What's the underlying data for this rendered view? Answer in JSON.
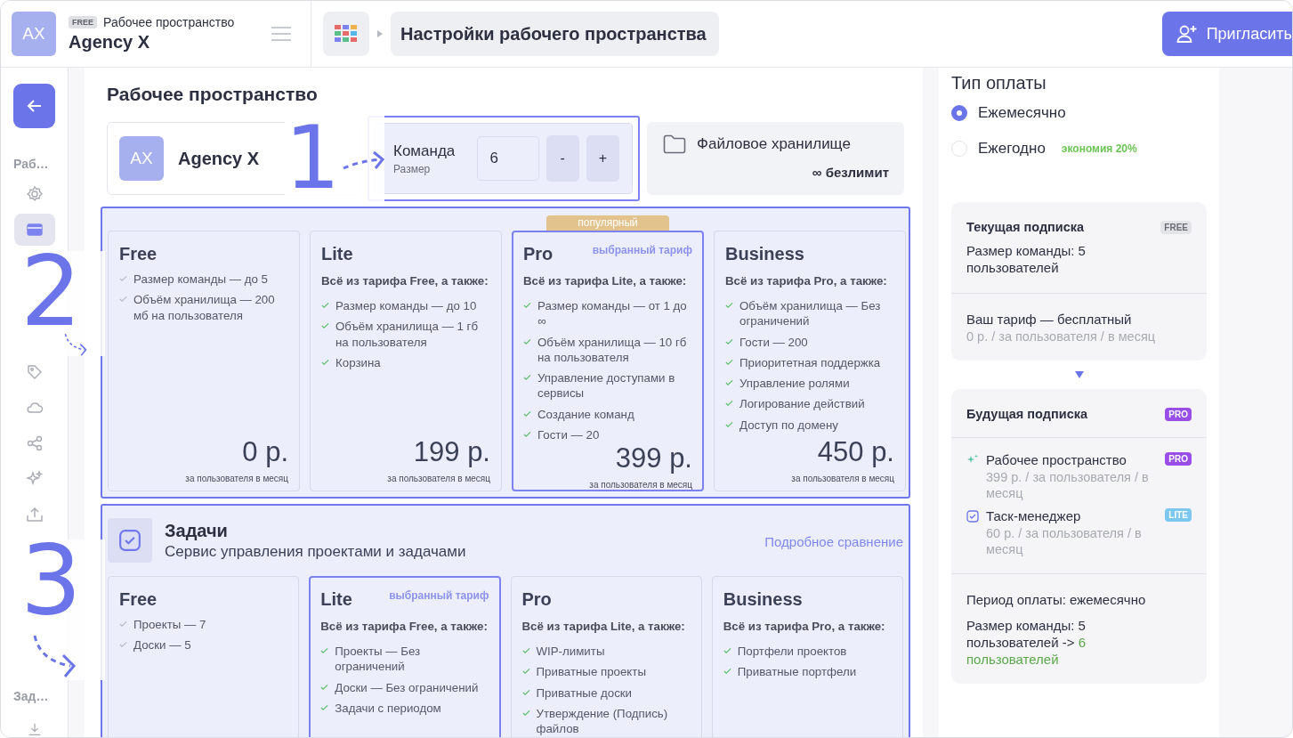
{
  "header": {
    "avatar": "AX",
    "plan_badge": "FREE",
    "workspace_label": "Рабочее пространство",
    "workspace_name": "Agency X",
    "breadcrumb": "Настройки рабочего пространства",
    "invite_button": "Пригласить"
  },
  "sidebar": {
    "back_selected": true,
    "section_1": "Раб…",
    "items": [
      {
        "kind": "gear",
        "selected": false
      },
      {
        "kind": "board",
        "selected": true
      },
      {
        "kind": "step",
        "text": "2"
      },
      {
        "kind": "tag",
        "selected": false
      },
      {
        "kind": "cloud",
        "selected": false
      },
      {
        "kind": "share",
        "selected": false
      },
      {
        "kind": "sparkles",
        "selected": false
      },
      {
        "kind": "upload",
        "selected": false
      },
      {
        "kind": "step",
        "text": "3"
      }
    ],
    "section_2": "Зад…"
  },
  "workspace": {
    "title": "Рабочее пространство",
    "step": "1",
    "avatar": "AX",
    "name": "Agency X",
    "team": {
      "label": "Команда",
      "sublabel": "Размер",
      "value": "6",
      "minus": "-",
      "plus": "+"
    },
    "storage": {
      "label": "Файловое хранилище",
      "value": "∞ безлимит"
    },
    "plans": [
      {
        "name": "Free",
        "features": [
          "Размер команды — до 5",
          "Объём хранилища — 200 мб на пользователя"
        ],
        "price": "0 р.",
        "per": "за пользователя в месяц",
        "selected": false
      },
      {
        "name": "Lite",
        "intro": "Всё из тарифа Free, а также:",
        "features": [
          "Размер команды — до 10",
          "Объём хранилища — 1 гб на пользователя",
          "Корзина"
        ],
        "price": "199 р.",
        "per": "за пользователя в месяц",
        "selected": false
      },
      {
        "name": "Pro",
        "ribbon": "популярный",
        "tag": "выбранный тариф",
        "intro": "Всё из тарифа Lite, а также:",
        "features": [
          "Размер команды — от 1 до ∞",
          "Объём хранилища — 10 гб на пользователя",
          "Управление доступами в сервисы",
          "Создание команд",
          "Гости — 20"
        ],
        "price": "399 р.",
        "per": "за пользователя в месяц",
        "selected": true
      },
      {
        "name": "Business",
        "intro": "Всё из тарифа Pro, а также:",
        "features": [
          "Объём хранилища — Без ограничений",
          "Гости — 200",
          "Приоритетная поддержка",
          "Управление ролями",
          "Логирование действий",
          "Доступ по домену"
        ],
        "price": "450 р.",
        "per": "за пользователя в месяц",
        "selected": false
      }
    ]
  },
  "tasks": {
    "title": "Задачи",
    "subtitle": "Сервис управления проектами и задачами",
    "link": "Подробное сравнение",
    "plans": [
      {
        "name": "Free",
        "features": [
          "Проекты — 7",
          "Доски — 5"
        ],
        "selected": false
      },
      {
        "name": "Lite",
        "tag": "выбранный тариф",
        "intro": "Всё из тарифа Free, а также:",
        "features": [
          "Проекты — Без ограничений",
          "Доски — Без ограничений",
          "Задачи с периодом"
        ],
        "selected": true
      },
      {
        "name": "Pro",
        "intro": "Всё из тарифа Lite, а также:",
        "features": [
          "WIP-лимиты",
          "Приватные проекты",
          "Приватные доски",
          "Утверждение (Подпись) файлов"
        ],
        "selected": false
      },
      {
        "name": "Business",
        "intro": "Всё из тарифа Pro, а также:",
        "features": [
          "Портфели проектов",
          "Приватные портфели"
        ],
        "selected": false
      }
    ]
  },
  "payment": {
    "title": "Тип оплаты",
    "options": [
      {
        "label": "Ежемесячно",
        "selected": true
      },
      {
        "label": "Ежегодно",
        "note": "экономия 20%",
        "selected": false
      }
    ]
  },
  "current": {
    "title": "Текущая подписка",
    "badge": {
      "text": "FREE",
      "kind": "free"
    },
    "team": "Размер команды: 5 пользователей",
    "plan": "Ваш тариф — бесплатный",
    "price": "0 р. / за пользователя / в месяц"
  },
  "future": {
    "title": "Будущая подписка",
    "badge": {
      "text": "PRO",
      "kind": "pro"
    },
    "items": [
      {
        "kind": "sparkles",
        "name": "Рабочее пространство",
        "price": "399 р. / за пользователя / в месяц",
        "badge": {
          "text": "PRO",
          "kind": "pro"
        }
      },
      {
        "kind": "check",
        "name": "Таск-менеджер",
        "price": "60 р. / за пользователя / в месяц",
        "badge": {
          "text": "LITE",
          "kind": "lite"
        }
      }
    ],
    "period": "Период оплаты: ежемесячно",
    "team_from": "Размер команды: 5 пользователей ->",
    "team_to": "6 пользователей"
  }
}
